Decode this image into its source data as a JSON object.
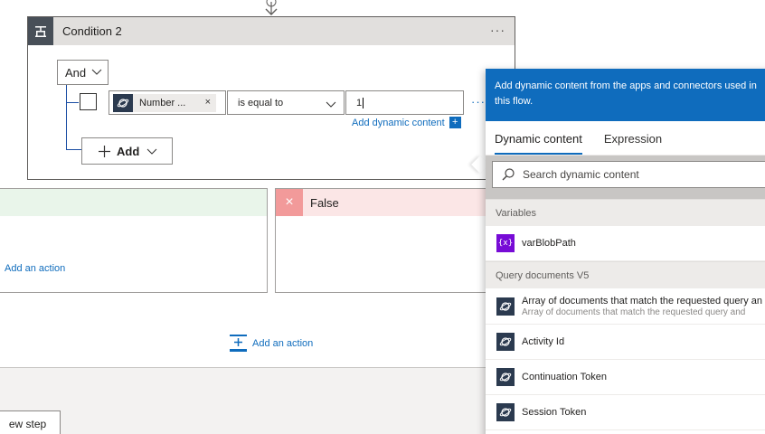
{
  "condition": {
    "title": "Condition 2",
    "more": "···",
    "group_operator": "And",
    "row": {
      "operand_left": "Number ...",
      "token_remove": "×",
      "operator": "is equal to",
      "operand_right": "1",
      "more": "···",
      "add_dynamic_label": "Add dynamic content",
      "add_dynamic_plus": "+"
    },
    "add_label": "Add"
  },
  "branches": {
    "true_add_action": "Add an action",
    "false_title": "False",
    "false_icon": "×"
  },
  "canvas": {
    "add_action": "Add an action",
    "new_step": "ew step"
  },
  "dynamic_panel": {
    "header": "Add dynamic content from the apps and connectors used in this flow.",
    "tabs": [
      "Dynamic content",
      "Expression"
    ],
    "search_placeholder": "Search dynamic content",
    "sections": [
      {
        "title": "Variables",
        "items": [
          {
            "label": "varBlobPath",
            "icon": "variable-icon"
          }
        ]
      },
      {
        "title": "Query documents V5",
        "items": [
          {
            "label": "Array of documents that match the requested query an",
            "sub": "Array of documents that match the requested query and",
            "icon": "cosmos-icon"
          },
          {
            "label": "Activity Id",
            "icon": "cosmos-icon"
          },
          {
            "label": "Continuation Token",
            "icon": "cosmos-icon"
          },
          {
            "label": "Session Token",
            "icon": "cosmos-icon"
          }
        ]
      }
    ]
  },
  "colors": {
    "accent": "#0f6cbd",
    "variable": "#770bd6",
    "cosmos": "#2b3a4f",
    "false_header": "#fbe6e6",
    "true_header": "#e9f5ea"
  }
}
